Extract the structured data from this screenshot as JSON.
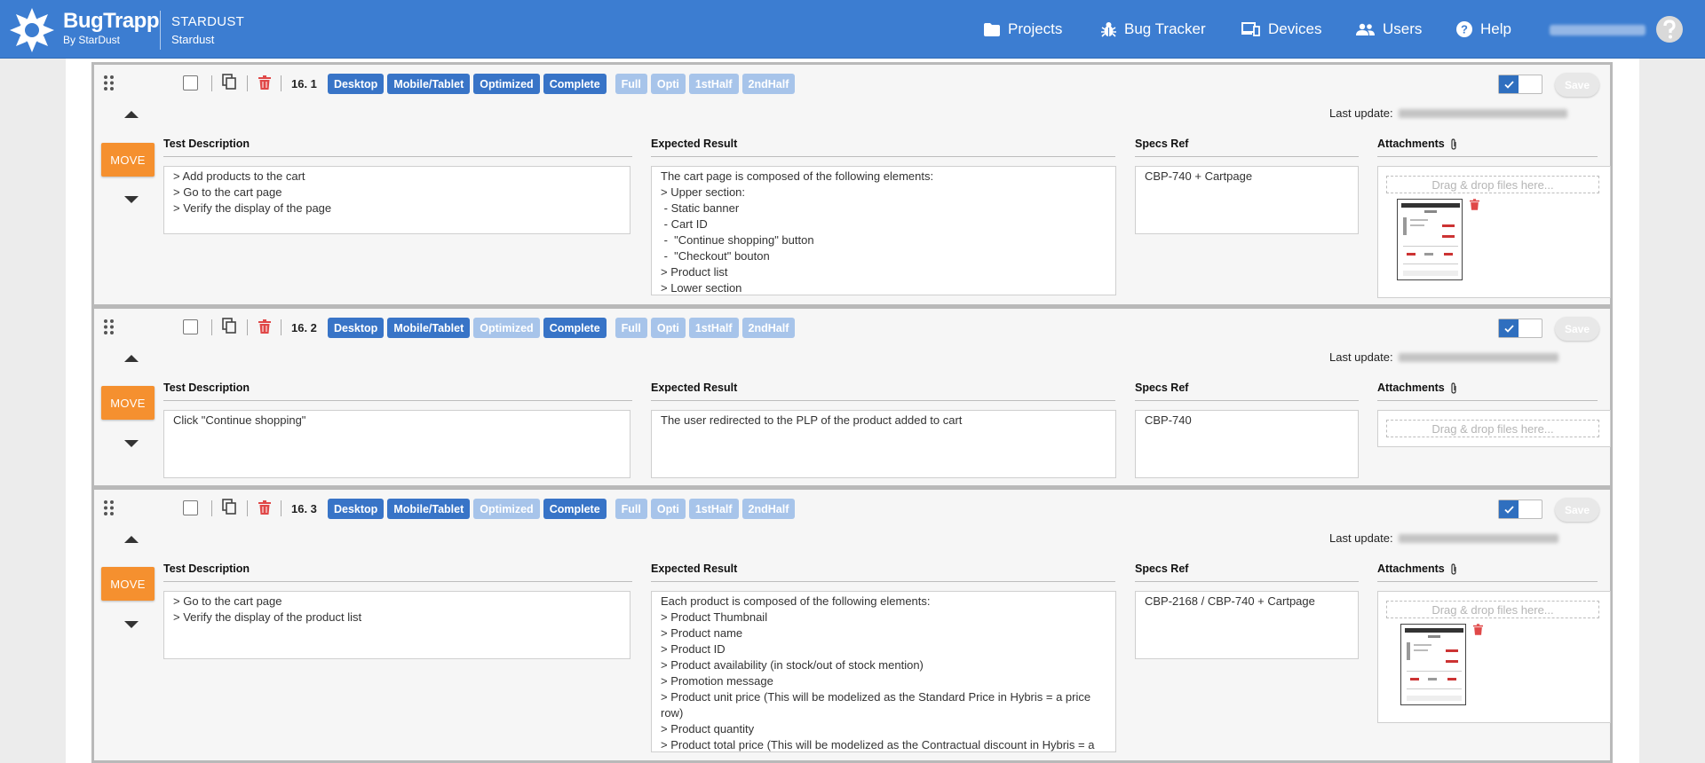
{
  "app": {
    "brand_name": "BugTrapp",
    "brand_sub": "By StarDust",
    "project_code": "STARDUST",
    "project_name": "Stardust"
  },
  "nav": {
    "projects": "Projects",
    "bug_tracker": "Bug Tracker",
    "devices": "Devices",
    "users": "Users",
    "help": "Help"
  },
  "labels": {
    "move": "MOVE",
    "last_update": "Last update:",
    "test_description": "Test Description",
    "expected_result": "Expected Result",
    "specs_ref": "Specs Ref",
    "attachments": "Attachments",
    "drop_hint": "Drag & drop files here...",
    "save": "Save"
  },
  "tag_names": {
    "desktop": "Desktop",
    "mobile": "Mobile/Tablet",
    "optimized": "Optimized",
    "complete": "Complete",
    "full": "Full",
    "opti": "Opti",
    "first_half": "1stHalf",
    "second_half": "2ndHalf"
  },
  "steps": [
    {
      "number": "16. 1",
      "optimized_active": true,
      "test_description": "> Add products to the cart\n> Go to the cart page\n> Verify the display of the page",
      "expected_result": "The cart page is composed of the following elements:\n> Upper section:\n - Static banner\n - Cart ID\n -  \"Continue shopping\" button\n -  \"Checkout\" bouton\n> Product list\n> Lower section",
      "specs_ref": "CBP-740 + Cartpage",
      "has_attachment": true
    },
    {
      "number": "16. 2",
      "optimized_active": false,
      "test_description": "Click \"Continue shopping\"",
      "expected_result": "The user redirected to the PLP of the product added to cart",
      "specs_ref": "CBP-740",
      "has_attachment": false
    },
    {
      "number": "16. 3",
      "optimized_active": false,
      "test_description": "> Go to the cart page\n> Verify the display of the product list",
      "expected_result": "Each product is composed of the following elements:\n> Product Thumbnail\n> Product name\n> Product ID\n> Product availability (in stock/out of stock mention)\n> Promotion message\n> Product unit price (This will be modelized as the Standard Price in Hybris = a price row)\n> Product quantity\n> Product total price (This will be modelized as the Contractual discount in Hybris = a",
      "specs_ref": "CBP-2168 / CBP-740 + Cartpage",
      "has_attachment": true
    }
  ],
  "colors": {
    "header": "#3c7dd1",
    "tag_active": "#3874c7",
    "tag_inactive": "#a7c4ea",
    "move_button": "#f5902f",
    "trash": "#e04848"
  }
}
